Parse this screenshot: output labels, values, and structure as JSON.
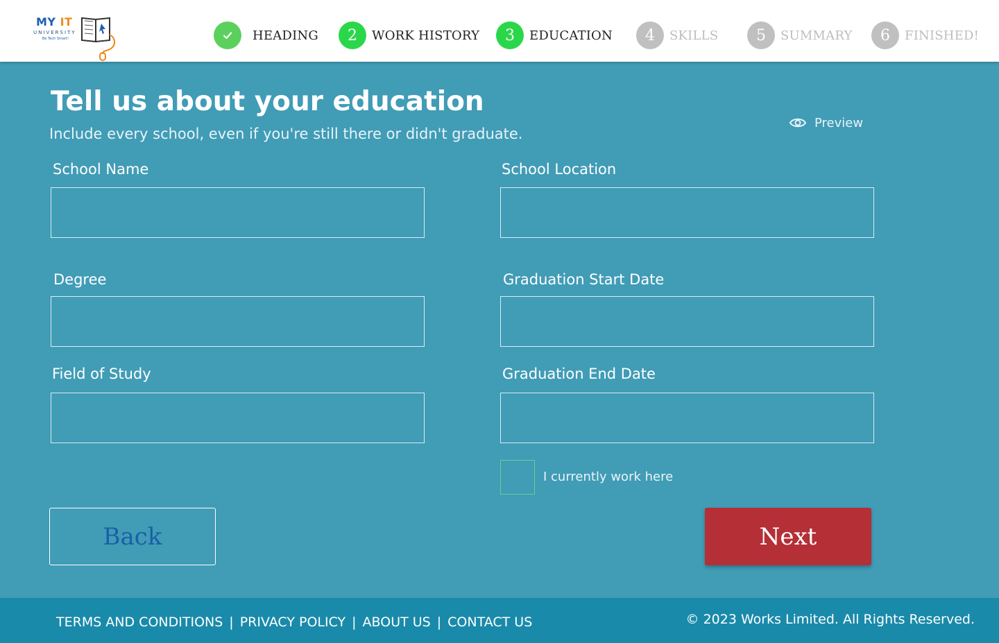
{
  "logo": {
    "brand_my": "MY",
    "brand_it": "IT",
    "university": "UNIVERSITY",
    "tagline": "Be Tech Smart!"
  },
  "steps": [
    {
      "number": "",
      "label": "HEADING",
      "state": "done",
      "icon": "check-icon"
    },
    {
      "number": "2",
      "label": "WORK HISTORY",
      "state": "active"
    },
    {
      "number": "3",
      "label": "EDUCATION",
      "state": "active"
    },
    {
      "number": "4",
      "label": "SKILLS",
      "state": "pending"
    },
    {
      "number": "5",
      "label": "SUMMARY",
      "state": "pending"
    },
    {
      "number": "6",
      "label": "FINISHED!",
      "state": "pending"
    }
  ],
  "main": {
    "title": "Tell us about your education",
    "subtitle": "Include every school, even if you're still there or didn't graduate.",
    "preview_label": "Preview"
  },
  "form": {
    "school_name": {
      "label": "School Name",
      "value": ""
    },
    "school_location": {
      "label": "School Location",
      "value": ""
    },
    "degree": {
      "label": "Degree",
      "value": ""
    },
    "grad_start": {
      "label": "Graduation Start Date",
      "value": ""
    },
    "field_of_study": {
      "label": "Field of Study",
      "value": ""
    },
    "grad_end": {
      "label": "Graduation End Date",
      "value": ""
    },
    "currently_work_label": "I currently work here",
    "currently_work_checked": false
  },
  "buttons": {
    "back": "Back",
    "next": "Next"
  },
  "footer": {
    "links": [
      "TERMS AND CONDITIONS",
      "PRIVACY POLICY",
      "ABOUT US",
      "CONTACT US"
    ],
    "separator": "|",
    "copyright": "© 2023 Works Limited. All Rights Reserved."
  },
  "colors": {
    "background": "#419cb6",
    "footer": "#1a8aaa",
    "next_button": "#b42f36",
    "step_done": "#5cd05c",
    "step_active": "#2bd74a",
    "step_pending": "#c0c0c0"
  }
}
